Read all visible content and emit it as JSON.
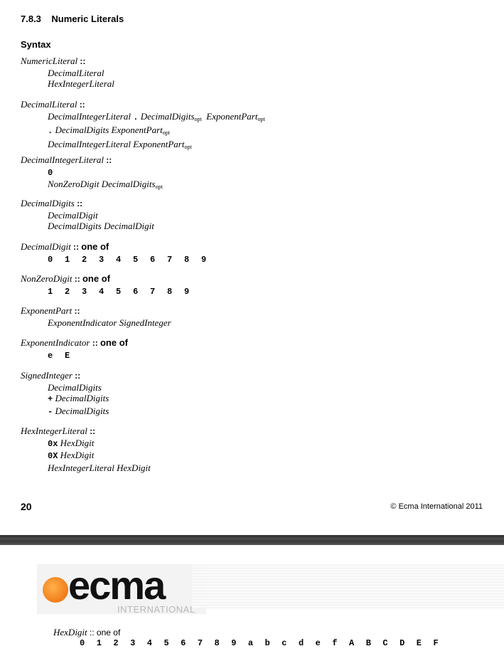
{
  "section": {
    "number": "7.8.3",
    "title": "Numeric Literals"
  },
  "syntax_heading": "Syntax",
  "sep": "::",
  "one_of": "one of",
  "opt": "opt",
  "productions": {
    "numeric_literal": {
      "lhs": "NumericLiteral",
      "alt1": "DecimalLiteral",
      "alt2": "HexIntegerLiteral"
    },
    "decimal_literal": {
      "lhs": "DecimalLiteral",
      "a1_p1": "DecimalIntegerLiteral",
      "dot": ".",
      "a1_p2": "DecimalDigits",
      "a1_p3": "ExponentPart",
      "a2_p1": "DecimalDigits",
      "a2_p2": "ExponentPart",
      "a3_p1": "DecimalIntegerLiteral",
      "a3_p2": "ExponentPart"
    },
    "decimal_integer_literal": {
      "lhs": "DecimalIntegerLiteral",
      "zero": "0",
      "a2_p1": "NonZeroDigit",
      "a2_p2": "DecimalDigits"
    },
    "decimal_digits": {
      "lhs": "DecimalDigits",
      "alt1": "DecimalDigit",
      "a2_p1": "DecimalDigits",
      "a2_p2": "DecimalDigit"
    },
    "decimal_digit": {
      "lhs": "DecimalDigit",
      "values": [
        "0",
        "1",
        "2",
        "3",
        "4",
        "5",
        "6",
        "7",
        "8",
        "9"
      ]
    },
    "non_zero_digit": {
      "lhs": "NonZeroDigit",
      "values": [
        "1",
        "2",
        "3",
        "4",
        "5",
        "6",
        "7",
        "8",
        "9"
      ]
    },
    "exponent_part": {
      "lhs": "ExponentPart",
      "p1": "ExponentIndicator",
      "p2": "SignedInteger"
    },
    "exponent_indicator": {
      "lhs": "ExponentIndicator",
      "values": [
        "e",
        "E"
      ]
    },
    "signed_integer": {
      "lhs": "SignedInteger",
      "alt1": "DecimalDigits",
      "plus": "+",
      "minus": "-",
      "digits": "DecimalDigits"
    },
    "hex_integer_literal": {
      "lhs": "HexIntegerLiteral",
      "prefix_lower": "0x",
      "prefix_upper": "0X",
      "hexdigit": "HexDigit",
      "a3_p1": "HexIntegerLiteral",
      "a3_p2": "HexDigit"
    }
  },
  "footer": {
    "page_number": "20",
    "copyright": "© Ecma International 2011"
  },
  "logo": {
    "text": "ecma",
    "subtext": "INTERNATIONAL",
    "dot_color": "#f07d1a"
  },
  "next_page": {
    "lhs": "HexDigit",
    "sep_text": ":: one of",
    "values": [
      "0",
      "1",
      "2",
      "3",
      "4",
      "5",
      "6",
      "7",
      "8",
      "9",
      "a",
      "b",
      "c",
      "d",
      "e",
      "f",
      "A",
      "B",
      "C",
      "D",
      "E",
      "F"
    ]
  }
}
